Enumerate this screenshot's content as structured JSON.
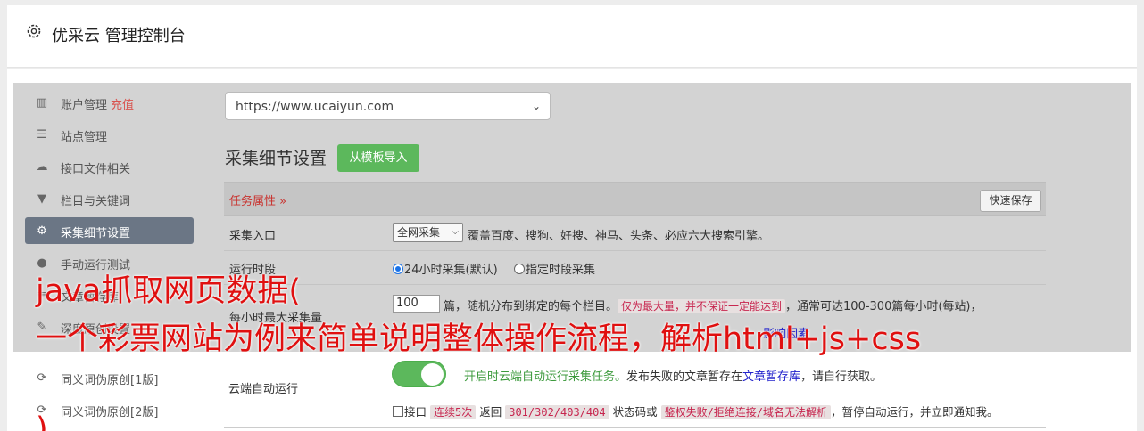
{
  "header": {
    "title": "优采云 管理控制台"
  },
  "sidebar": {
    "items": [
      {
        "icon": "bar-chart-icon",
        "label": "账户管理",
        "badge": "充值"
      },
      {
        "icon": "server-icon",
        "label": "站点管理"
      },
      {
        "icon": "cloud-upload-icon",
        "label": "接口文件相关"
      },
      {
        "icon": "filter-icon",
        "label": "栏目与关键词"
      },
      {
        "icon": "gears-icon",
        "label": "采集细节设置",
        "active": true
      },
      {
        "icon": "play-icon",
        "label": "手动运行测试"
      },
      {
        "icon": "list-icon",
        "label": "文章暂存库"
      },
      {
        "icon": "edit-icon",
        "label": "深度原创设置"
      },
      {
        "icon": "refresh-icon",
        "label": "同义词伪原创[1版]"
      },
      {
        "icon": "refresh-icon",
        "label": "同义词伪原创[2版]"
      }
    ]
  },
  "site_select": {
    "value": "https://www.ucaiyun.com"
  },
  "section": {
    "title": "采集细节设置",
    "import_button": "从模板导入"
  },
  "task_attr": {
    "label": "任务属性",
    "caret": "»",
    "save_button": "快速保存"
  },
  "rows": {
    "entry": {
      "label": "采集入口",
      "select_value": "全网采集",
      "desc": "覆盖百度、搜狗、好搜、神马、头条、必应六大搜索引擎。"
    },
    "time": {
      "label": "运行时段",
      "option1": "24小时采集(默认)",
      "option2": "指定时段采集"
    },
    "max": {
      "label": "每小时最大采集量",
      "input_value": "100",
      "desc1": "篇，随机分布到绑定的每个栏目。",
      "note": "仅为最大量，并不保证一定能达到",
      "desc2": "，通常可达100-300篇每小时(每站)，",
      "link_tail": "影响因素"
    }
  },
  "cloud": {
    "label": "云端自动运行",
    "on_text": "开启时云端自动运行采集任务。",
    "desc": "发布失败的文章暂存在",
    "link": "文章暂存库",
    "desc_tail": "，请自行获取。",
    "cb_prefix": "接口",
    "code1": "连续5次",
    "mid1": "返回",
    "code2": "301/302/403/404",
    "mid2": "状态码或",
    "code3": "鉴权失败/拒绝连接/域名无法解析",
    "tail": "，暂停自动运行，并立即通知我。"
  },
  "overlay": {
    "line1": "java抓取网页数据(",
    "line2": "一个彩票网站为例来简单说明整体操作流程，解析html+js+css",
    "line3": ")"
  },
  "colors": {
    "accent_green": "#5cb85c",
    "active_bg": "#6b7685",
    "overlay_red": "#e01010"
  }
}
